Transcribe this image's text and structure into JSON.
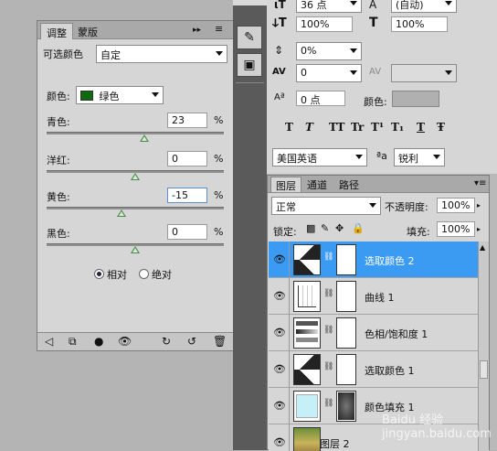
{
  "adjust_panel": {
    "tabs": [
      "调整",
      "蒙版"
    ],
    "title": "可选颜色",
    "preset": "自定",
    "color_label": "颜色:",
    "color_value": "绿色",
    "color_swatch": "#0d6b0d",
    "sliders": [
      {
        "label": "青色:",
        "value": "23",
        "unit": "%",
        "position": 0.55
      },
      {
        "label": "洋红:",
        "value": "0",
        "unit": "%",
        "position": 0.5
      },
      {
        "label": "黄色:",
        "value": "-15",
        "unit": "%",
        "position": 0.425
      },
      {
        "label": "黑色:",
        "value": "0",
        "unit": "%",
        "position": 0.5
      }
    ],
    "method_relative": "相对",
    "method_absolute": "绝对"
  },
  "char_panel": {
    "font_size": "36 点",
    "leading": "(自动)",
    "vscale": "100%",
    "hscale": "100%",
    "tsume": "0%",
    "tracking": "0",
    "baseline": "0 点",
    "color_label": "颜色:",
    "style_buttons": [
      "T",
      "T",
      "TT",
      "Tr",
      "T¹",
      "T₁",
      "T",
      "Ŧ"
    ],
    "language": "美国英语",
    "aa_label": "ªa",
    "antialias": "锐利"
  },
  "layers_panel": {
    "tabs": [
      "图层",
      "通道",
      "路径"
    ],
    "blend_mode": "正常",
    "opacity_label": "不透明度:",
    "opacity": "100%",
    "lock_label": "锁定:",
    "fill_label": "填充:",
    "fill": "100%",
    "layers": [
      {
        "name": "选取颜色 2",
        "selected": true,
        "thumb": "selective-color"
      },
      {
        "name": "曲线 1",
        "selected": false,
        "thumb": "curves"
      },
      {
        "name": "色相/饱和度 1",
        "selected": false,
        "thumb": "hue-saturation"
      },
      {
        "name": "选取颜色 1",
        "selected": false,
        "thumb": "selective-color"
      },
      {
        "name": "颜色填充 1",
        "selected": false,
        "thumb": "color-fill"
      },
      {
        "name": "图层 2",
        "selected": false,
        "thumb": "photo"
      }
    ]
  },
  "watermark": "Baidu 经验 jingyan.baidu.com"
}
